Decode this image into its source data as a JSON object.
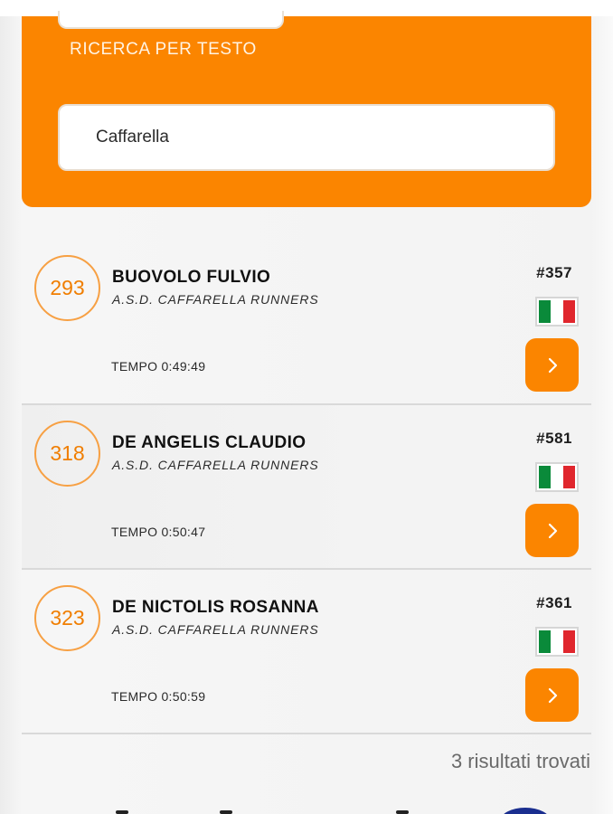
{
  "search": {
    "label": "RICERCA PER TESTO",
    "value": "Caffarella"
  },
  "results": [
    {
      "rank": "293",
      "name": "BUOVOLO FULVIO",
      "club": "A.S.D. CAFFARELLA RUNNERS",
      "time": "TEMPO 0:49:49",
      "bib": "#357",
      "flag": "italy-flag-icon"
    },
    {
      "rank": "318",
      "name": "DE ANGELIS CLAUDIO",
      "club": "A.S.D. CAFFARELLA RUNNERS",
      "time": "TEMPO 0:50:47",
      "bib": "#581",
      "flag": "italy-flag-icon"
    },
    {
      "rank": "323",
      "name": "DE NICTOLIS ROSANNA",
      "club": "A.S.D. CAFFARELLA RUNNERS",
      "time": "TEMPO 0:50:59",
      "bib": "#361",
      "flag": "italy-flag-icon"
    }
  ],
  "footer": {
    "count_text": "3 risultati trovati"
  },
  "colors": {
    "accent": "#fb8500",
    "rank_text": "#f07e00",
    "rank_border": "#f7a043"
  }
}
